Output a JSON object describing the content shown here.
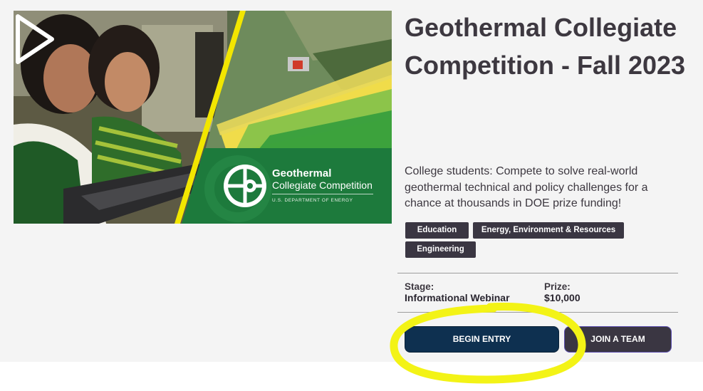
{
  "hero": {
    "media": "competition-promo-video",
    "logo": {
      "title": "Geothermal",
      "subtitle": "Collegiate Competition",
      "department": "U.S. DEPARTMENT OF ENERGY"
    },
    "play_icon": "play-icon"
  },
  "competition": {
    "title": "Geothermal Collegiate Competition - Fall 2023",
    "description": "College students: Compete to solve real-world geothermal technical and policy challenges for a chance at thousands in DOE prize funding!",
    "tags": [
      "Education",
      "Energy, Environment & Resources",
      "Engineering"
    ],
    "stage_label": "Stage:",
    "stage_value": "Informational Webinar",
    "prize_label": "Prize:",
    "prize_value": "$10,000"
  },
  "actions": {
    "begin_entry": "BEGIN ENTRY",
    "join_team": "JOIN A TEAM"
  },
  "colors": {
    "panel": "#f4f4f4",
    "text": "#3d3840",
    "tag_bg": "#3a3642",
    "primary_button": "#0e3050",
    "secondary_button": "#3a3642",
    "logo_green": "#1d7a3c",
    "accent_yellow": "#f2e600",
    "highlight": "#f3f316"
  }
}
